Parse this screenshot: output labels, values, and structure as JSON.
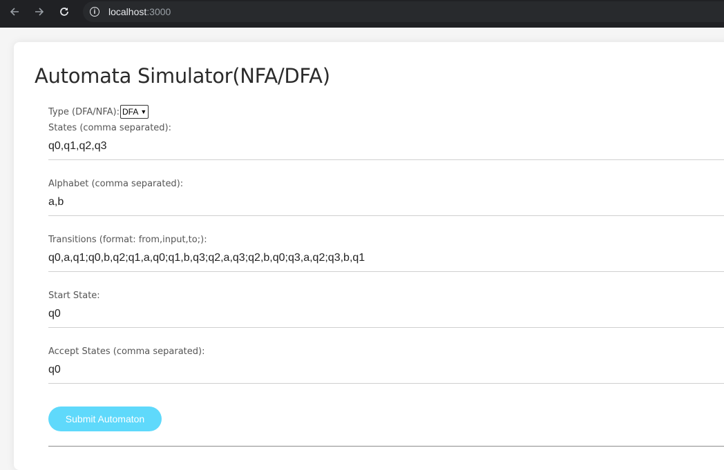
{
  "browser": {
    "url_host": "localhost",
    "url_port": ":3000"
  },
  "page": {
    "title": "Automata Simulator(NFA/DFA)",
    "type_label": "Type (DFA/NFA):",
    "type_value": "DFA",
    "type_options_visible": [
      "DFA"
    ],
    "fields": [
      {
        "label": "States (comma separated):",
        "value": "q0,q1,q2,q3"
      },
      {
        "label": "Alphabet (comma separated):",
        "value": "a,b"
      },
      {
        "label": "Transitions (format: from,input,to;):",
        "value": "q0,a,q1;q0,b,q2;q1,a,q0;q1,b,q3;q2,a,q3;q2,b,q0;q3,a,q2;q3,b,q1"
      },
      {
        "label": "Start State:",
        "value": "q0"
      },
      {
        "label": "Accept States (comma separated):",
        "value": "q0"
      }
    ],
    "submit_label": "Submit Automaton"
  },
  "colors": {
    "browser_bar": "#202124",
    "submit_button": "#5fd9fb"
  },
  "icons": [
    "back-arrow-icon",
    "forward-arrow-icon",
    "reload-icon",
    "info-icon",
    "chevron-down-icon"
  ]
}
